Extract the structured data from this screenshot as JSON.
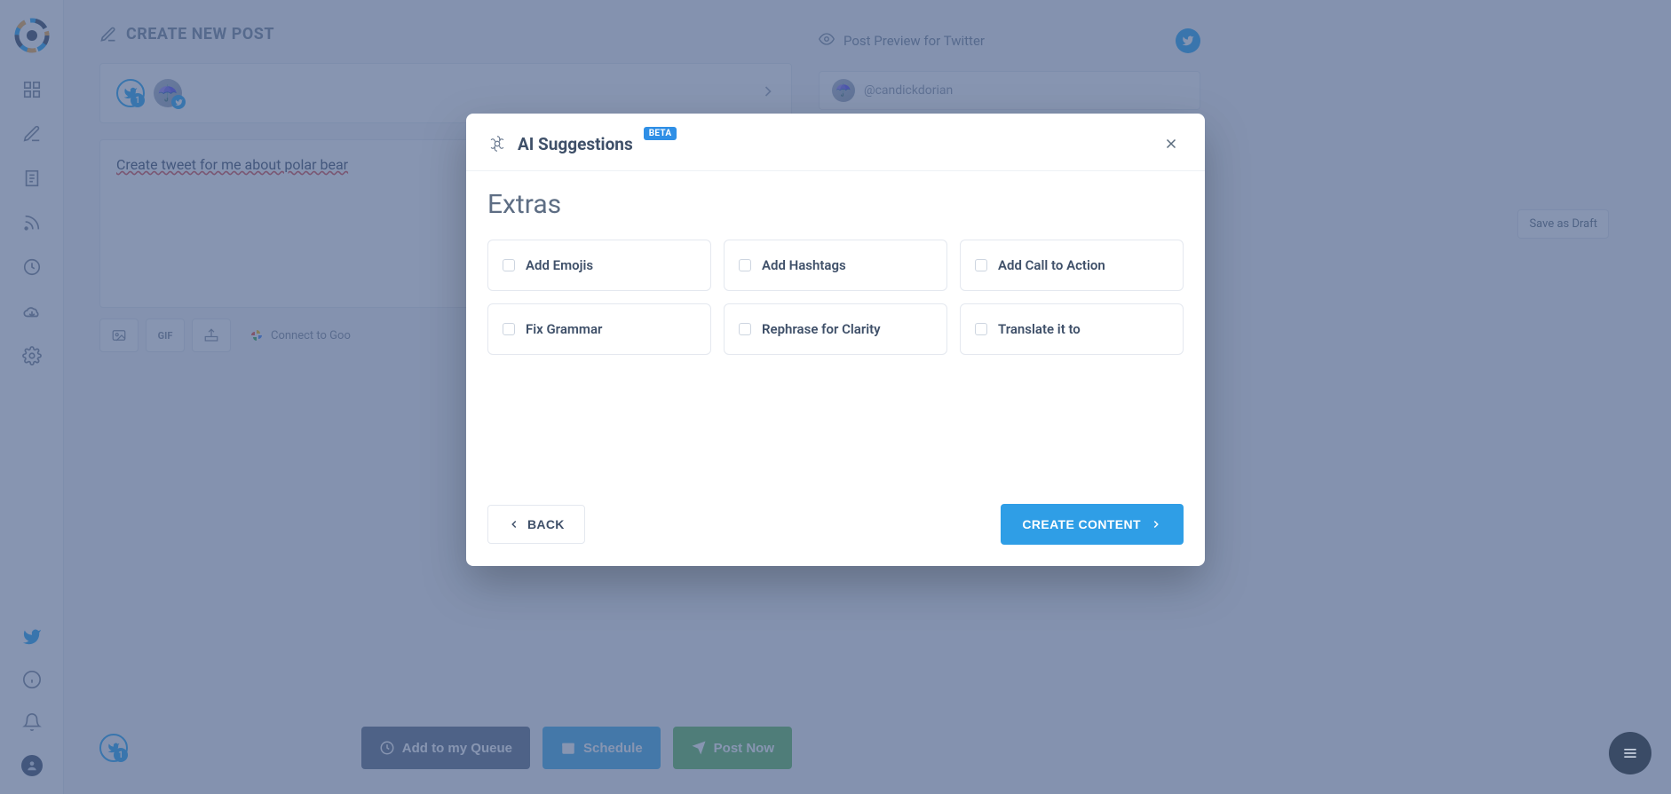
{
  "page": {
    "title": "CREATE NEW POST"
  },
  "accounts": {
    "twitter_count": "1"
  },
  "compose": {
    "text": "Create tweet for me about polar bear",
    "gif_label": "GIF",
    "google_photos_label": "Connect to Goo"
  },
  "actions": {
    "queue": "Add to my Queue",
    "schedule": "Schedule",
    "post_now": "Post Now",
    "footer_count": "1"
  },
  "preview": {
    "header": "Post Preview for Twitter",
    "handle": "@candickdorian",
    "save_draft": "Save as Draft"
  },
  "modal": {
    "title": "AI Suggestions",
    "badge": "BETA",
    "section": "Extras",
    "options": {
      "add_emojis": "Add Emojis",
      "add_hashtags": "Add Hashtags",
      "add_cta": "Add Call to Action",
      "fix_grammar": "Fix Grammar",
      "rephrase": "Rephrase for Clarity",
      "translate": "Translate it to"
    },
    "back": "BACK",
    "create": "CREATE CONTENT"
  }
}
